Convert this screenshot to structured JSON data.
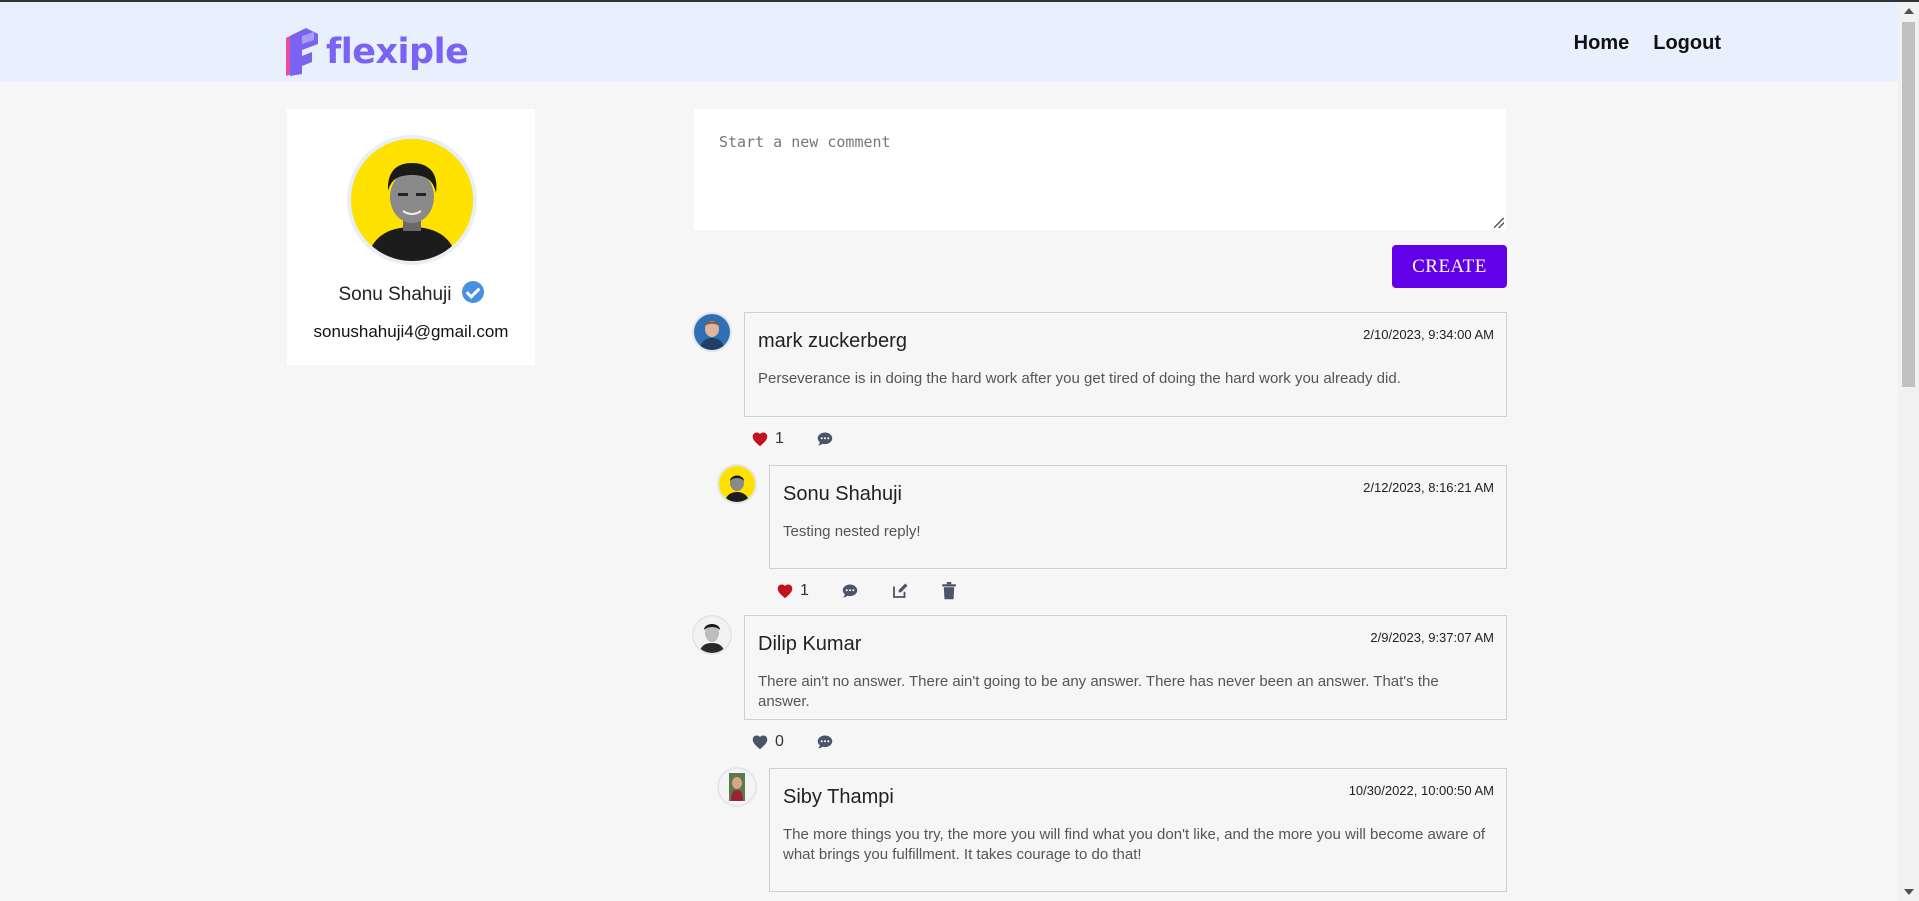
{
  "brand": {
    "name": "flexiple",
    "color": "#7a63f2"
  },
  "nav": {
    "home": "Home",
    "logout": "Logout"
  },
  "profile": {
    "name": "Sonu Shahuji",
    "email": "sonushahuji4@gmail.com",
    "verified": true,
    "avatar_bg": "#ffe100"
  },
  "composer": {
    "placeholder": "Start a new comment",
    "value": ""
  },
  "create_button": {
    "label": "CREATE",
    "color": "#6200ea"
  },
  "comments": [
    {
      "author": "mark zuckerberg",
      "date": "2/10/2023, 9:34:00 AM",
      "text": "Perseverance is in doing the hard work after you get tired of doing the hard work you already did.",
      "likes": "1",
      "liked": true,
      "replies": [
        {
          "author": "Sonu Shahuji",
          "date": "2/12/2023, 8:16:21 AM",
          "text": "Testing nested reply!",
          "likes": "1",
          "liked": true
        }
      ]
    },
    {
      "author": "Dilip Kumar",
      "date": "2/9/2023, 9:37:07 AM",
      "text": "There ain't no answer. There ain't going to be any answer. There has never been an answer. That's the answer.",
      "likes": "0",
      "liked": false,
      "replies": [
        {
          "author": "Siby Thampi",
          "date": "10/30/2022, 10:00:50 AM",
          "text": "The more things you try, the more you will find what you don't like, and the more you will become aware of what brings you fulfillment. It takes courage to do that!"
        }
      ]
    }
  ],
  "colors": {
    "like_active": "#c1121f",
    "like_inactive": "#4a5568",
    "icon": "#4a5568"
  }
}
